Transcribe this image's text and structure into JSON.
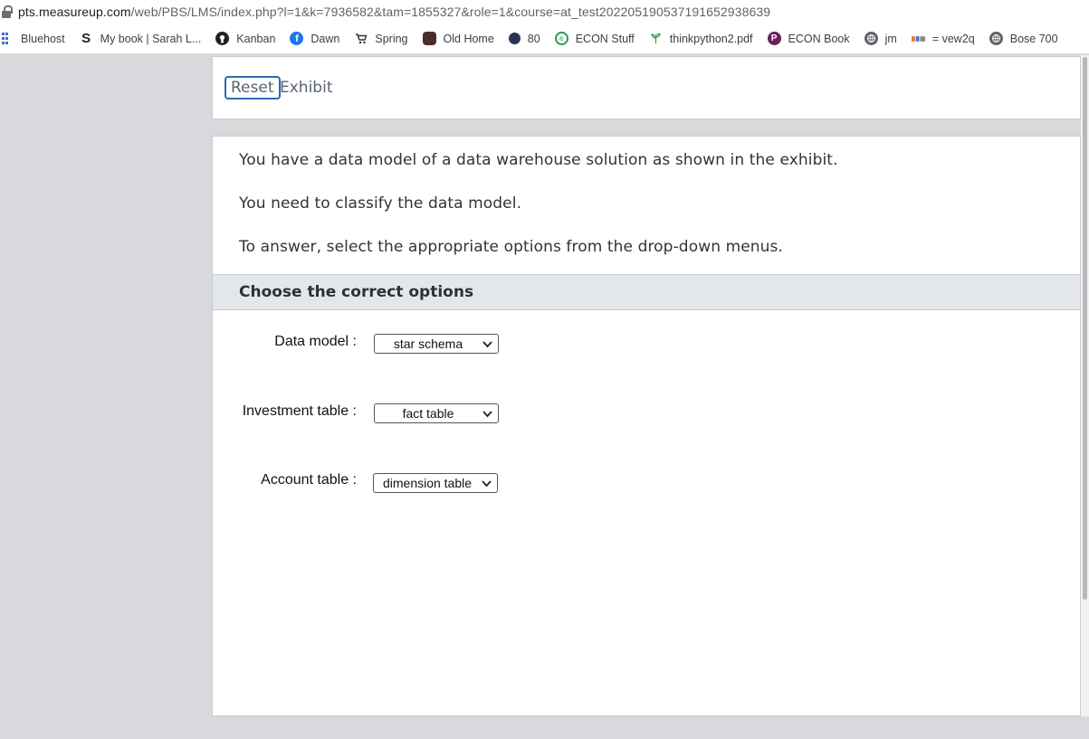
{
  "browser": {
    "url_host": "pts.measureup.com",
    "url_path": "/web/PBS/LMS/index.php?l=1&k=7936582&tam=1855327&role=1&course=at_test20220519053719165293863​9"
  },
  "bookmarks": [
    {
      "label": "Bluehost",
      "icon": "grid-icon",
      "color": "#3b6fd6"
    },
    {
      "label": "My book | Sarah L...",
      "icon": "s-logo-icon",
      "color": "#222222"
    },
    {
      "label": "Kanban",
      "icon": "github-icon",
      "color": "#222222"
    },
    {
      "label": "Dawn",
      "icon": "facebook-icon",
      "color": "#1877f2"
    },
    {
      "label": "Spring",
      "icon": "cart-icon",
      "color": "#333333"
    },
    {
      "label": "Old Home",
      "icon": "bear-icon",
      "color": "#4a2c2a"
    },
    {
      "label": "80",
      "icon": "dot-icon",
      "color": "#2d3255"
    },
    {
      "label": "ECON Stuff",
      "icon": "green-circle-icon",
      "color": "#1f9d55"
    },
    {
      "label": "thinkpython2.pdf",
      "icon": "sprout-icon",
      "color": "#3a8f3a"
    },
    {
      "label": "ECON Book",
      "icon": "p-logo-icon",
      "color": "#6b1f5a"
    },
    {
      "label": "jm",
      "icon": "globe-icon",
      "color": "#5f6368"
    },
    {
      "label": "= vew2q",
      "icon": "bar-logo-icon",
      "color": "#e07a2b"
    },
    {
      "label": "Bose 700",
      "icon": "globe-icon",
      "color": "#5f6368"
    }
  ],
  "exhibit_bar": {
    "reset_label": "Reset",
    "exhibit_label": "Exhibit"
  },
  "question": {
    "line1": "You have a data model of a data warehouse solution as shown in the exhibit.",
    "line2": "You need to classify the data model.",
    "line3": "To answer, select the appropriate options from the drop-down menus."
  },
  "options": {
    "title": "Choose the correct options",
    "rows": [
      {
        "label": "Data model :",
        "selected": "star schema"
      },
      {
        "label": "Investment table :",
        "selected": "fact table"
      },
      {
        "label": "Account table :",
        "selected": "dimension table"
      }
    ]
  }
}
